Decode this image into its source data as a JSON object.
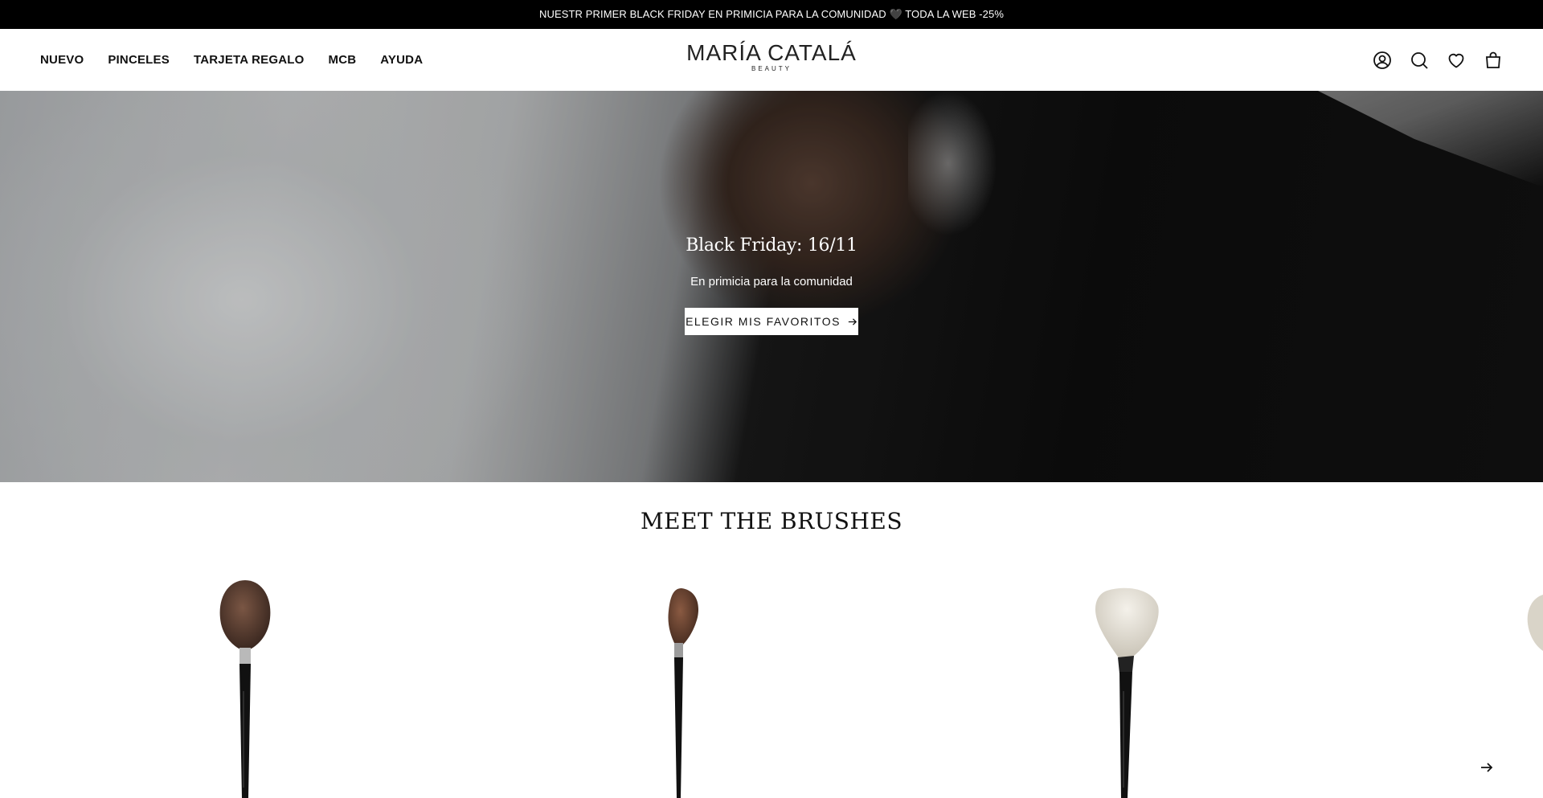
{
  "announcement": {
    "text": "NUESTR PRIMER BLACK FRIDAY EN PRIMICIA PARA LA COMUNIDAD 🖤 TODA LA WEB -25%"
  },
  "header": {
    "nav": [
      "NUEVO",
      "PINCELES",
      "TARJETA REGALO",
      "MCB",
      "AYUDA"
    ],
    "logo": {
      "main": "MARÍA CATALÁ",
      "sub": "BEAUTY"
    },
    "icons": [
      "account-icon",
      "search-icon",
      "heart-icon",
      "bag-icon"
    ]
  },
  "hero": {
    "title": "Black Friday: 16/11",
    "subtitle": "En primicia para la comunidad",
    "cta": "ELEGIR MIS FAVORITOS"
  },
  "section": {
    "title": "MEET THE BRUSHES"
  },
  "products": [
    {
      "name": "brush-1",
      "head_color": "#4a3328"
    },
    {
      "name": "brush-2",
      "head_color": "#5a3a2c"
    },
    {
      "name": "brush-3",
      "head_color": "#e6e2d8"
    },
    {
      "name": "brush-4",
      "head_color": "#d8d4cc"
    }
  ],
  "colors": {
    "announcement_bg": "#000000",
    "accent": "#111111"
  }
}
